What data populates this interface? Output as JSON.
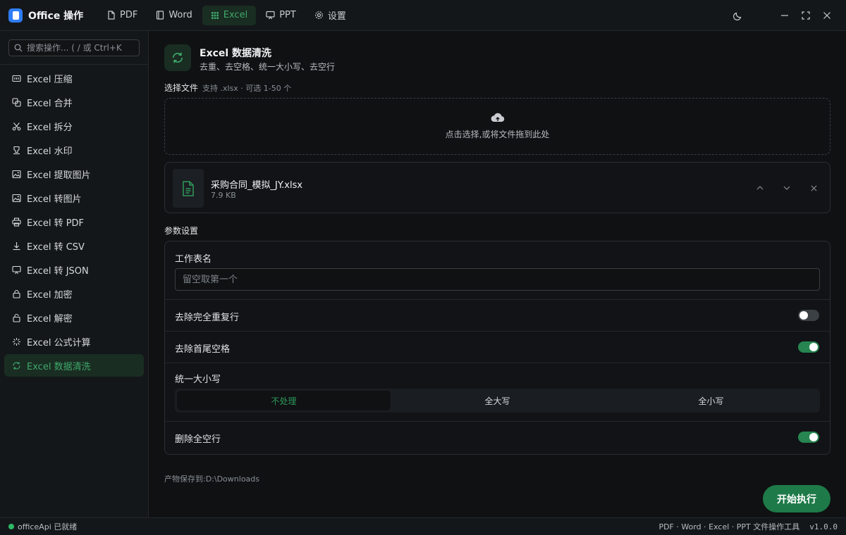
{
  "app": {
    "title": "Office 操作"
  },
  "nav": {
    "tabs": [
      {
        "label": "PDF",
        "icon": "document-icon"
      },
      {
        "label": "Word",
        "icon": "book-icon"
      },
      {
        "label": "Excel",
        "icon": "grid-icon",
        "active": true
      },
      {
        "label": "PPT",
        "icon": "presentation-icon"
      },
      {
        "label": "设置",
        "icon": "gear-icon"
      }
    ]
  },
  "window": {
    "controls": [
      "theme-moon-icon",
      "minimize-icon",
      "maximize-icon",
      "close-icon"
    ]
  },
  "sidebar": {
    "search_placeholder": "搜索操作... ( / 或 Ctrl+K",
    "items": [
      {
        "label": "Excel 压缩",
        "icon": "compress-icon"
      },
      {
        "label": "Excel 合并",
        "icon": "merge-icon"
      },
      {
        "label": "Excel 拆分",
        "icon": "scissors-icon"
      },
      {
        "label": "Excel 水印",
        "icon": "stamp-icon"
      },
      {
        "label": "Excel 提取图片",
        "icon": "image-icon"
      },
      {
        "label": "Excel 转图片",
        "icon": "image-icon"
      },
      {
        "label": "Excel 转 PDF",
        "icon": "printer-icon"
      },
      {
        "label": "Excel 转 CSV",
        "icon": "download-icon"
      },
      {
        "label": "Excel 转 JSON",
        "icon": "presentation-icon"
      },
      {
        "label": "Excel 加密",
        "icon": "lock-icon"
      },
      {
        "label": "Excel 解密",
        "icon": "unlock-icon"
      },
      {
        "label": "Excel 公式计算",
        "icon": "sparkle-icon"
      },
      {
        "label": "Excel 数据清洗",
        "icon": "refresh-icon",
        "active": true
      }
    ]
  },
  "tool": {
    "title": "Excel 数据清洗",
    "description": "去重、去空格、统一大小写、去空行",
    "icon": "refresh-icon"
  },
  "file_select": {
    "label": "选择文件",
    "hint": "支持 .xlsx · 可选 1-50 个",
    "dropzone_text": "点击选择,或将文件拖到此处"
  },
  "files": [
    {
      "name": "采购合同_模拟_JY.xlsx",
      "size": "7.9 KB"
    }
  ],
  "params": {
    "label": "参数设置",
    "sheet_name_label": "工作表名",
    "sheet_name_placeholder": "留空取第一个",
    "sheet_name_value": "",
    "dedupe_label": "去除完全重复行",
    "dedupe_on": false,
    "trim_label": "去除首尾空格",
    "trim_on": true,
    "case_label": "统一大小写",
    "case_options": [
      "不处理",
      "全大写",
      "全小写"
    ],
    "case_selected": "不处理",
    "remove_empty_label": "删除全空行",
    "remove_empty_on": true
  },
  "save_path": "产物保存到:D:\\Downloads",
  "run_button": "开始执行",
  "status": {
    "text": "officeApi 已就绪",
    "dot_color": "#2fb866",
    "right_text": "PDF · Word · Excel · PPT 文件操作工具",
    "version": "v1.0.0"
  },
  "colors": {
    "accent": "#2f9a5b",
    "accent_bg": "#1a2d22",
    "toggle_on": "#268550"
  }
}
